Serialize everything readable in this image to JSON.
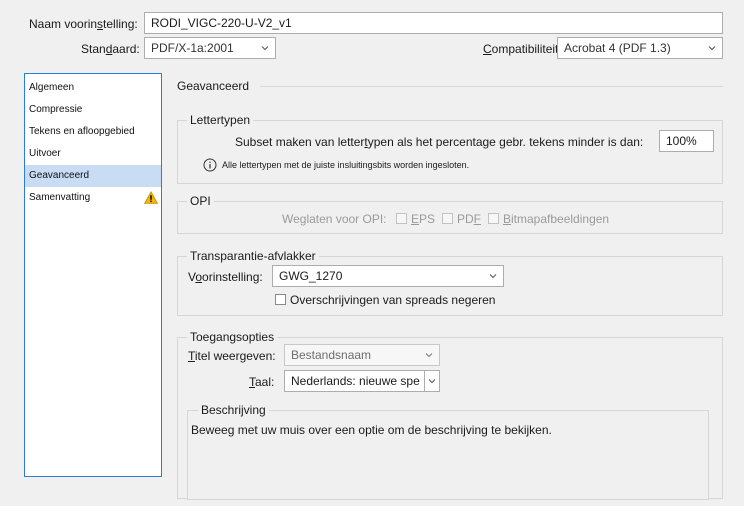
{
  "header": {
    "preset_name_label_pre": "Naam voorin",
    "preset_name_label_u": "s",
    "preset_name_label_post": "telling:",
    "preset_name_value": "RODI_VIGC-220-U-V2_v1",
    "standard_label_pre": "Stan",
    "standard_label_u": "d",
    "standard_label_post": "aard:",
    "standard_value": "PDF/X-1a:2001",
    "compat_label_pre": "",
    "compat_label_u": "C",
    "compat_label_post": "ompatibiliteit:",
    "compat_value": "Acrobat 4 (PDF 1.3)"
  },
  "sidebar": {
    "items": [
      {
        "label": "Algemeen"
      },
      {
        "label": "Compressie"
      },
      {
        "label": "Tekens en afloopgebied"
      },
      {
        "label": "Uitvoer"
      },
      {
        "label": "Geavanceerd",
        "selected": true
      },
      {
        "label": "Samenvatting",
        "warning": true
      }
    ]
  },
  "panel": {
    "title": "Geavanceerd",
    "fonts": {
      "title": "Lettertypen",
      "subset_label_pre": "Subset maken van letter",
      "subset_label_u": "t",
      "subset_label_post": "ypen als het percentage gebr. tekens minder is dan:",
      "subset_value": "100%",
      "info_text": "Alle lettertypen met de juiste insluitingsbits worden ingesloten."
    },
    "opi": {
      "title": "OPI",
      "omit_label": "Weglaten voor OPI:",
      "eps_u": "E",
      "eps_rest": "PS",
      "pdf_pre": "PD",
      "pdf_u": "F",
      "bitmap_u": "B",
      "bitmap_rest": "itmapafbeeldingen"
    },
    "flattener": {
      "title": "Transparantie-afvlakker",
      "preset_label_pre": "V",
      "preset_label_u": "o",
      "preset_label_post": "orinstelling:",
      "preset_value": "GWG_1270",
      "ignore_pre": "Overschrijvingen van spreads ne",
      "ignore_u": "g",
      "ignore_post": "eren"
    },
    "access": {
      "title": "Toegangsopties",
      "title_show_u": "T",
      "title_show_rest": "itel weergeven:",
      "title_show_value": "Bestandsnaam",
      "lang_u": "T",
      "lang_rest": "aal:",
      "lang_value": "Nederlands: nieuwe spe"
    },
    "description": {
      "title": "Beschrijving",
      "text": "Beweeg met uw muis over een optie om de beschrijving te bekijken."
    }
  },
  "colors": {
    "accent": "#2f7bd8",
    "selected_bg": "#c8dcf3",
    "warning": "#f2b600"
  }
}
